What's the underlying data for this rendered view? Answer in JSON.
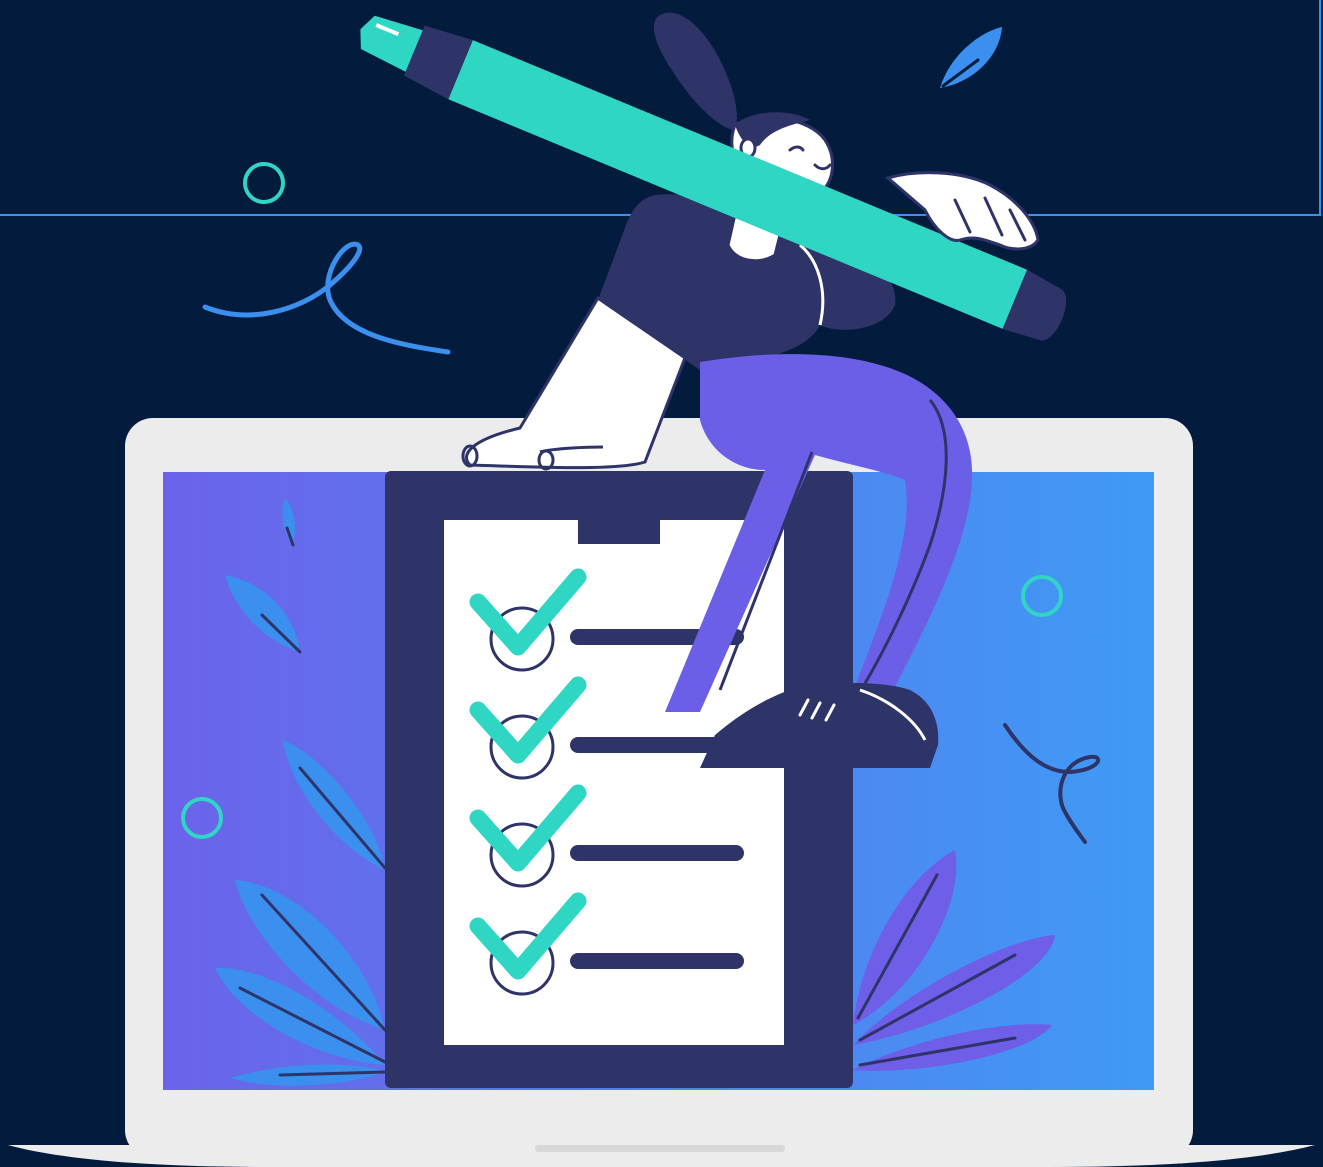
{
  "illustration": {
    "subject": "checklist-illustration",
    "checklist": {
      "items": [
        {
          "checked": true
        },
        {
          "checked": true
        },
        {
          "checked": true
        },
        {
          "checked": true
        }
      ]
    },
    "colors": {
      "background": "#031c3d",
      "frame_line": "#3f8fef",
      "laptop_body": "#ececec",
      "screen_left": "#6b63ea",
      "screen_right": "#3f9af5",
      "clipboard": "#2f3468",
      "paper": "#ffffff",
      "check": "#2fd6c4",
      "pencil": "#2fd6c4",
      "pants": "#6b5fe8",
      "shirt": "#2f3468",
      "skin": "#ffffff",
      "leaf_blue": "#3a8fef",
      "leaf_purple": "#6e5ee8"
    },
    "icons": [
      "pencil-icon",
      "clipboard-icon",
      "checkmark-icon",
      "laptop-icon",
      "leaf-icon",
      "ring-icon",
      "squiggle-icon"
    ]
  }
}
